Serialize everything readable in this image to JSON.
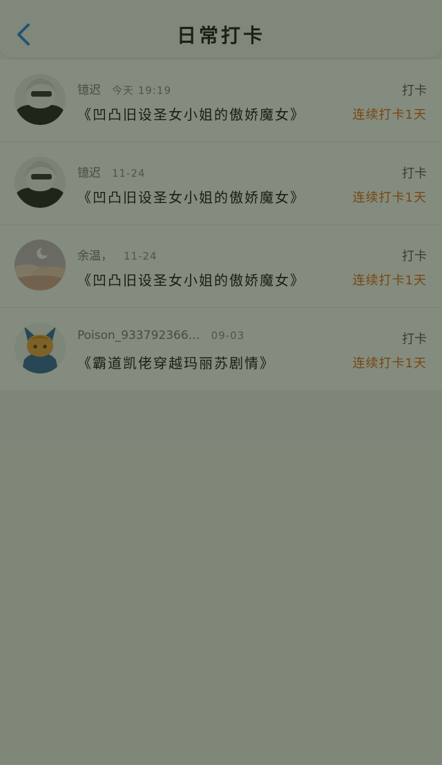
{
  "header": {
    "title": "日常打卡",
    "back_icon": "chevron-left-icon",
    "accent_color": "#2f8de4"
  },
  "records": [
    {
      "avatar_icon": "avatar-anime-white-hair",
      "user": "镱迟",
      "time": "今天 19:19",
      "book": "《凹凸旧设圣女小姐的傲娇魔女》",
      "action": "打卡",
      "streak": "连续打卡1天"
    },
    {
      "avatar_icon": "avatar-anime-white-hair",
      "user": "镱迟",
      "time": "11-24",
      "book": "《凹凸旧设圣女小姐的傲娇魔女》",
      "action": "打卡",
      "streak": "连续打卡1天"
    },
    {
      "avatar_icon": "avatar-moon-sky",
      "user": "余温，",
      "time": "11-24",
      "book": "《凹凸旧设圣女小姐的傲娇魔女》",
      "action": "打卡",
      "streak": "连续打卡1天"
    },
    {
      "avatar_icon": "avatar-anime-cat-ears",
      "user": "Poison_933792366…",
      "time": "09-03",
      "book": "《霸道凯佬穿越玛丽苏剧情》",
      "action": "打卡",
      "streak": "连续打卡1天"
    }
  ],
  "colors": {
    "streak": "#e56d1b",
    "dim_overlay": "rgba(20,35,10,0.52)"
  }
}
